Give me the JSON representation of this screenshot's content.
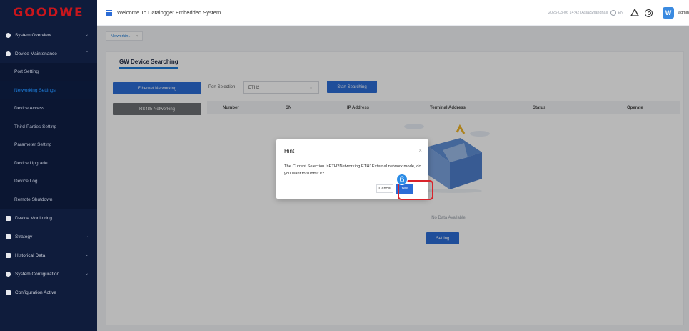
{
  "brand": {
    "logo_text": "GOODWE",
    "accent": "#2b6cd6",
    "brand_red": "#c9161c"
  },
  "header": {
    "title": "Welcome To Datalogger Embedded System",
    "datetime": "2025-03-06 14:42 [Asia/Shanghai]",
    "language": "EN",
    "avatar_letter": "W",
    "username": "admin"
  },
  "sidebar": {
    "groups": [
      {
        "label": "System Overview",
        "icon": "globe-icon",
        "chevron": "⌄"
      },
      {
        "label": "Device Maintenance",
        "icon": "shield-icon",
        "chevron": "⌃",
        "items": [
          {
            "label": "Port Setting",
            "active": false
          },
          {
            "label": "Networking Settings",
            "active": true
          },
          {
            "label": "Device Access",
            "active": false
          },
          {
            "label": "Third-Parties Setting",
            "active": false
          },
          {
            "label": "Parameter Setting",
            "active": false
          },
          {
            "label": "Device Upgrade",
            "active": false
          },
          {
            "label": "Device Log",
            "active": false
          },
          {
            "label": "Remote Shutdown",
            "active": false
          }
        ]
      },
      {
        "label": "Device Monitoring",
        "icon": "monitor-icon",
        "chevron": ""
      },
      {
        "label": "Strategy",
        "icon": "strategy-icon",
        "chevron": "⌄"
      },
      {
        "label": "Historical Data",
        "icon": "history-icon",
        "chevron": "⌄"
      },
      {
        "label": "System Configuration",
        "icon": "gear-icon",
        "chevron": "⌄"
      },
      {
        "label": "Configuration Active",
        "icon": "config-icon",
        "chevron": ""
      }
    ]
  },
  "tabs": [
    {
      "label": "Networkin...",
      "close": "×"
    }
  ],
  "main": {
    "card_title": "GW Device Searching",
    "ethernet_button": "Ethernet Networking",
    "rs485_button": "RS485 Networking",
    "port_selection_label": "Port Selection",
    "port_selection_value": "ETH2",
    "start_button": "Start Searching",
    "table_columns": [
      "Number",
      "SN",
      "IP Address",
      "Terminal Address",
      "Status",
      "Operate"
    ],
    "empty_text": "No Data Available",
    "setting_button": "Setting"
  },
  "dialog": {
    "title": "Hint",
    "close": "×",
    "message": "The Current Selection IsETH2Networking,ETH1External network mode, do you want to submit it?",
    "cancel": "Cancel",
    "confirm": "Yes"
  },
  "annotation": {
    "step": "6"
  }
}
